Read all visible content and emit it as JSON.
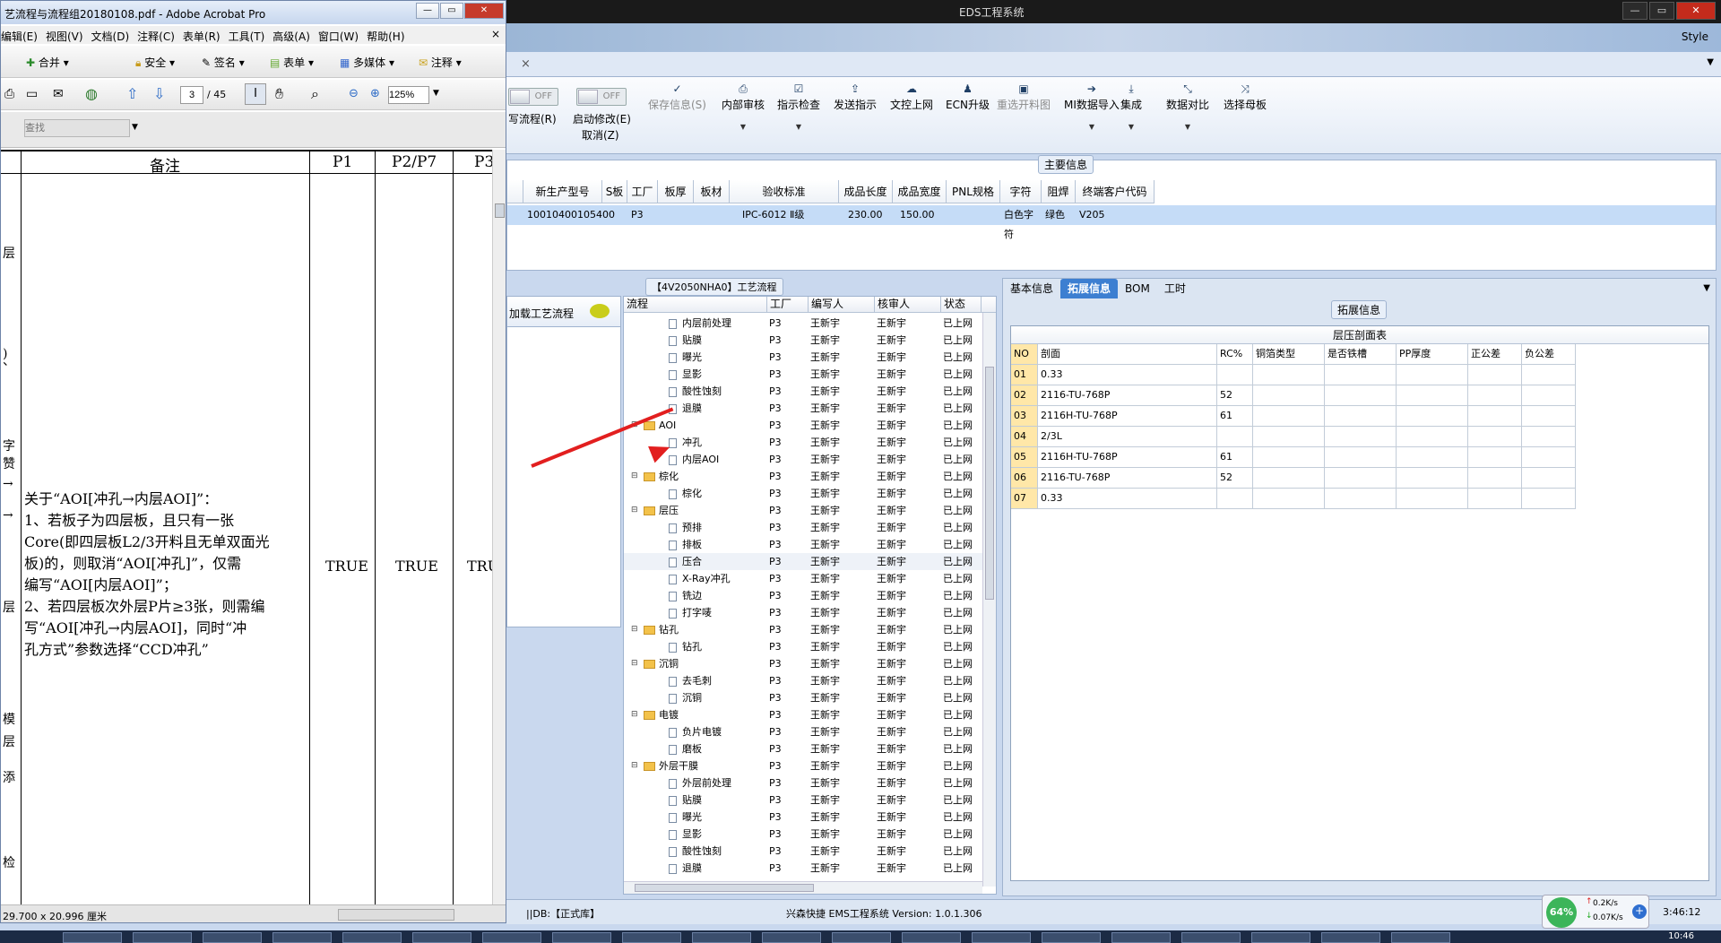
{
  "eds": {
    "title": "EDS工程系统",
    "style_label": "Style",
    "tab_close": "×",
    "toolbar": {
      "flow_label": "写流程(R)",
      "toggle_off": "OFF",
      "start_edit": "启动修改(E)",
      "cancel": "取消(Z)",
      "items": [
        "保存信息(S)",
        "内部审核",
        "指示检查",
        "发送指示",
        "文控上网",
        "ECN升级",
        "重选开料图",
        "MI数据导入",
        "集成",
        "数据对比",
        "选择母板"
      ]
    },
    "main_info": {
      "label": "主要信息",
      "headers": [
        "新生产型号",
        "S板",
        "工厂",
        "板厚",
        "板材",
        "验收标准",
        "成品长度",
        "成品宽度",
        "PNL规格",
        "字符",
        "阻焊",
        "终端客户代码"
      ],
      "row": [
        "10010400105400",
        "",
        "P3",
        "",
        "",
        "IPC-6012 Ⅱ级",
        "230.00",
        "150.00",
        "",
        "白色字符",
        "绿色",
        "V205"
      ]
    },
    "left_pane": {
      "label": "加载工艺流程"
    },
    "tree": {
      "title": "【4V2050NHA0】工艺流程",
      "headers": [
        "流程",
        "工厂",
        "编写人",
        "核审人",
        "状态"
      ],
      "rows": [
        {
          "name": "内层前处理",
          "f": "P3",
          "w": "王新宇",
          "r": "王新宇",
          "s": "已上网",
          "lvl": 2
        },
        {
          "name": "贴膜",
          "f": "P3",
          "w": "王新宇",
          "r": "王新宇",
          "s": "已上网",
          "lvl": 2
        },
        {
          "name": "曝光",
          "f": "P3",
          "w": "王新宇",
          "r": "王新宇",
          "s": "已上网",
          "lvl": 2
        },
        {
          "name": "显影",
          "f": "P3",
          "w": "王新宇",
          "r": "王新宇",
          "s": "已上网",
          "lvl": 2
        },
        {
          "name": "酸性蚀刻",
          "f": "P3",
          "w": "王新宇",
          "r": "王新宇",
          "s": "已上网",
          "lvl": 2
        },
        {
          "name": "退膜",
          "f": "P3",
          "w": "王新宇",
          "r": "王新宇",
          "s": "已上网",
          "lvl": 2
        },
        {
          "name": "AOI",
          "f": "P3",
          "w": "王新宇",
          "r": "王新宇",
          "s": "已上网",
          "lvl": 1
        },
        {
          "name": "冲孔",
          "f": "P3",
          "w": "王新宇",
          "r": "王新宇",
          "s": "已上网",
          "lvl": 2
        },
        {
          "name": "内层AOI",
          "f": "P3",
          "w": "王新宇",
          "r": "王新宇",
          "s": "已上网",
          "lvl": 2
        },
        {
          "name": "棕化",
          "f": "P3",
          "w": "王新宇",
          "r": "王新宇",
          "s": "已上网",
          "lvl": 1
        },
        {
          "name": "棕化",
          "f": "P3",
          "w": "王新宇",
          "r": "王新宇",
          "s": "已上网",
          "lvl": 2
        },
        {
          "name": "层压",
          "f": "P3",
          "w": "王新宇",
          "r": "王新宇",
          "s": "已上网",
          "lvl": 1
        },
        {
          "name": "预排",
          "f": "P3",
          "w": "王新宇",
          "r": "王新宇",
          "s": "已上网",
          "lvl": 2
        },
        {
          "name": "排板",
          "f": "P3",
          "w": "王新宇",
          "r": "王新宇",
          "s": "已上网",
          "lvl": 2
        },
        {
          "name": "压合",
          "f": "P3",
          "w": "王新宇",
          "r": "王新宇",
          "s": "已上网",
          "lvl": 2
        },
        {
          "name": "X-Ray冲孔",
          "f": "P3",
          "w": "王新宇",
          "r": "王新宇",
          "s": "已上网",
          "lvl": 2
        },
        {
          "name": "铣边",
          "f": "P3",
          "w": "王新宇",
          "r": "王新宇",
          "s": "已上网",
          "lvl": 2
        },
        {
          "name": "打字唛",
          "f": "P3",
          "w": "王新宇",
          "r": "王新宇",
          "s": "已上网",
          "lvl": 2
        },
        {
          "name": "钻孔",
          "f": "P3",
          "w": "王新宇",
          "r": "王新宇",
          "s": "已上网",
          "lvl": 1
        },
        {
          "name": "钻孔",
          "f": "P3",
          "w": "王新宇",
          "r": "王新宇",
          "s": "已上网",
          "lvl": 2
        },
        {
          "name": "沉铜",
          "f": "P3",
          "w": "王新宇",
          "r": "王新宇",
          "s": "已上网",
          "lvl": 1
        },
        {
          "name": "去毛刺",
          "f": "P3",
          "w": "王新宇",
          "r": "王新宇",
          "s": "已上网",
          "lvl": 2
        },
        {
          "name": "沉铜",
          "f": "P3",
          "w": "王新宇",
          "r": "王新宇",
          "s": "已上网",
          "lvl": 2
        },
        {
          "name": "电镀",
          "f": "P3",
          "w": "王新宇",
          "r": "王新宇",
          "s": "已上网",
          "lvl": 1
        },
        {
          "name": "负片电镀",
          "f": "P3",
          "w": "王新宇",
          "r": "王新宇",
          "s": "已上网",
          "lvl": 2
        },
        {
          "name": "磨板",
          "f": "P3",
          "w": "王新宇",
          "r": "王新宇",
          "s": "已上网",
          "lvl": 2
        },
        {
          "name": "外层干膜",
          "f": "P3",
          "w": "王新宇",
          "r": "王新宇",
          "s": "已上网",
          "lvl": 1
        },
        {
          "name": "外层前处理",
          "f": "P3",
          "w": "王新宇",
          "r": "王新宇",
          "s": "已上网",
          "lvl": 2
        },
        {
          "name": "贴膜",
          "f": "P3",
          "w": "王新宇",
          "r": "王新宇",
          "s": "已上网",
          "lvl": 2
        },
        {
          "name": "曝光",
          "f": "P3",
          "w": "王新宇",
          "r": "王新宇",
          "s": "已上网",
          "lvl": 2
        },
        {
          "name": "显影",
          "f": "P3",
          "w": "王新宇",
          "r": "王新宇",
          "s": "已上网",
          "lvl": 2
        },
        {
          "name": "酸性蚀刻",
          "f": "P3",
          "w": "王新宇",
          "r": "王新宇",
          "s": "已上网",
          "lvl": 2
        },
        {
          "name": "退膜",
          "f": "P3",
          "w": "王新宇",
          "r": "王新宇",
          "s": "已上网",
          "lvl": 2
        }
      ]
    },
    "right_tabs": [
      "基本信息",
      "拓展信息",
      "BOM",
      "工时"
    ],
    "ext_label": "拓展信息",
    "layer_table": {
      "title": "层压剖面表",
      "headers": [
        "NO",
        "剖面",
        "RC%",
        "铜箔类型",
        "是否铁槽",
        "PP厚度",
        "正公差",
        "负公差"
      ],
      "rows": [
        [
          "01",
          "0.33",
          "",
          "",
          "",
          "",
          "",
          ""
        ],
        [
          "02",
          "2116-TU-768P",
          "52",
          "",
          "",
          "",
          "",
          ""
        ],
        [
          "03",
          "2116H-TU-768P",
          "61",
          "",
          "",
          "",
          "",
          ""
        ],
        [
          "04",
          "2/3L",
          "",
          "",
          "",
          "",
          "",
          ""
        ],
        [
          "05",
          "2116H-TU-768P",
          "61",
          "",
          "",
          "",
          "",
          ""
        ],
        [
          "06",
          "2116-TU-768P",
          "52",
          "",
          "",
          "",
          "",
          ""
        ],
        [
          "07",
          "0.33",
          "",
          "",
          "",
          "",
          "",
          ""
        ]
      ]
    },
    "status": {
      "db": "||DB:【正式库】",
      "version": "兴森快捷 EMS工程系统 Version: 1.0.1.306",
      "net_percent": "64%",
      "up": "0.2K/s",
      "down": "0.07K/s",
      "time": "3:46:12",
      "clock": "10:46"
    }
  },
  "acrobat": {
    "title": "艺流程与流程组20180108.pdf - Adobe Acrobat Pro",
    "menu": [
      "编辑(E)",
      "视图(V)",
      "文档(D)",
      "注释(C)",
      "表单(R)",
      "工具(T)",
      "高级(A)",
      "窗口(W)",
      "帮助(H)"
    ],
    "tb1": [
      "合并",
      "安全",
      "签名",
      "表单",
      "多媒体",
      "注释"
    ],
    "page_current": "3",
    "page_total": "/ 45",
    "zoom": "125%",
    "search_placeholder": "查找",
    "close_x": "×",
    "table_headers": [
      "备注",
      "P1",
      "P2/P7",
      "P3"
    ],
    "note_lines": [
      "关于“AOI[冲孔→内层AOI]”：",
      "1、若板子为四层板，且只有一张",
      "Core(即四层板L2/3开料且无单双面光",
      "板)的，则取消“AOI[冲孔]”，仅需",
      "编写“AOI[内层AOI]”；",
      "2、若四层板次外层P片≥3张，则需编",
      "写“AOI[冲孔→内层AOI]，同时“冲",
      "孔方式”参数选择“CCD冲孔”"
    ],
    "true_vals": [
      "TRUE",
      "TRUE",
      "TRU"
    ],
    "left_chars": [
      "层",
      "、",
      ")",
      "字",
      "赞",
      "→",
      "→",
      "层",
      "模",
      "层",
      "添",
      "检"
    ],
    "status_size": "29.700 x 20.996 厘米"
  },
  "colors": {
    "accent": "#3d7fd1",
    "arrow": "#e21f1f",
    "row_select": "#c5dcf7"
  }
}
